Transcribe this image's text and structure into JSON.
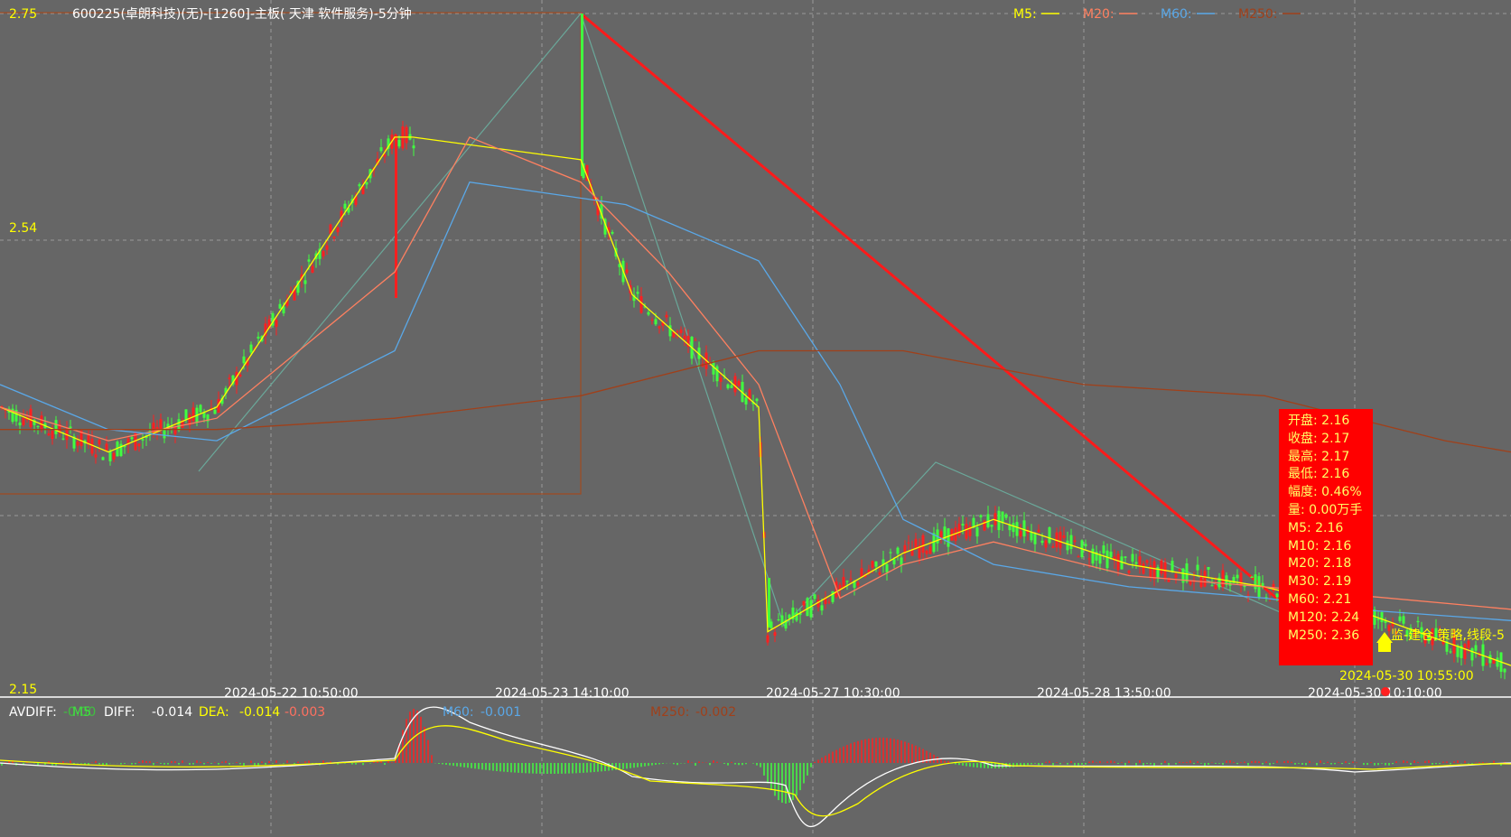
{
  "header": {
    "top_price": "2.75",
    "title": "600225(卓朗科技)(无)-[1260]-主板( 天津 软件服务)-5分钟",
    "mid_price": "2.54",
    "bottom_price": "2.15"
  },
  "legend": [
    {
      "label": "M5:",
      "color": "#ffff00"
    },
    {
      "label": "M20:",
      "color": "#ff8060"
    },
    {
      "label": "M60:",
      "color": "#5aa8e8"
    },
    {
      "label": "M250:",
      "color": "#a0401a"
    }
  ],
  "x_axis_labels": [
    "2024-05-22 10:50:00",
    "2024-05-23 14:10:00",
    "2024-05-27 10:30:00",
    "2024-05-28 13:50:00",
    "2024-05-30 10:10:00"
  ],
  "info_box": [
    {
      "k": "开盘:",
      "v": "2.16"
    },
    {
      "k": "收盘:",
      "v": "2.17"
    },
    {
      "k": "最高:",
      "v": "2.17"
    },
    {
      "k": "最低:",
      "v": "2.16"
    },
    {
      "k": "幅度:",
      "v": "0.46%"
    },
    {
      "k": "量:",
      "v": "0.00万手"
    },
    {
      "k": "M5:",
      "v": "2.16"
    },
    {
      "k": "M10:",
      "v": "2.16"
    },
    {
      "k": "M20:",
      "v": "2.18"
    },
    {
      "k": "M30:",
      "v": "2.19"
    },
    {
      "k": "M60:",
      "v": "2.21"
    },
    {
      "k": "M120:",
      "v": "2.24"
    },
    {
      "k": "M250:",
      "v": "2.36"
    }
  ],
  "signal": {
    "text": "监-建仓,策略,线段-5",
    "time": "2024-05-30 10:55:00"
  },
  "lower_panel": {
    "row": [
      {
        "text": "AVDIFF:",
        "color": "#ffffff"
      },
      {
        "text": "-0.00",
        "color": "#40c040"
      },
      {
        "text": "M5",
        "color": "#40e040"
      },
      {
        "text": "DIFF:",
        "color": "#ffffff"
      },
      {
        "text": "-0.014",
        "color": "#ffffff"
      },
      {
        "text": "DEA:",
        "color": "#ffff00"
      },
      {
        "text": "-0.014",
        "color": "#ffff00"
      },
      {
        "text": "-0.003",
        "color": "#ff7060"
      },
      {
        "text": "M60:",
        "color": "#5aa8e8"
      },
      {
        "text": "-0.001",
        "color": "#5aa8e8"
      },
      {
        "text": "M250:",
        "color": "#a0401a"
      },
      {
        "text": "-0.002",
        "color": "#a0401a"
      }
    ]
  },
  "chart_data": {
    "type": "candlestick",
    "ylim": [
      2.15,
      2.75
    ],
    "x": [
      "2024-05-22 10:50:00",
      "2024-05-23 14:10:00",
      "2024-05-27 10:30:00",
      "2024-05-28 13:50:00",
      "2024-05-30 10:10:00"
    ],
    "series": [
      {
        "name": "M5",
        "values": [
          2.4,
          2.36,
          2.4,
          2.64,
          2.64,
          2.62,
          2.5,
          2.4,
          2.2,
          2.27,
          2.3,
          2.26,
          2.24,
          2.22,
          2.17
        ]
      },
      {
        "name": "M20",
        "values": [
          2.4,
          2.37,
          2.39,
          2.52,
          2.64,
          2.6,
          2.52,
          2.42,
          2.23,
          2.26,
          2.28,
          2.25,
          2.24,
          2.22,
          2.18
        ]
      },
      {
        "name": "M60",
        "values": [
          2.42,
          2.38,
          2.37,
          2.45,
          2.6,
          2.58,
          2.53,
          2.42,
          2.3,
          2.26,
          2.24,
          2.23,
          2.22,
          2.21
        ]
      },
      {
        "name": "M250",
        "values": [
          2.38,
          2.38,
          2.39,
          2.41,
          2.45,
          2.45,
          2.42,
          2.41,
          2.39,
          2.37,
          2.36
        ]
      }
    ],
    "macd": {
      "diff": -0.014,
      "dea": -0.014
    }
  },
  "colors": {
    "bg": "#666666",
    "up": "#ff2020",
    "down": "#40ff40",
    "grid": "#999999"
  }
}
